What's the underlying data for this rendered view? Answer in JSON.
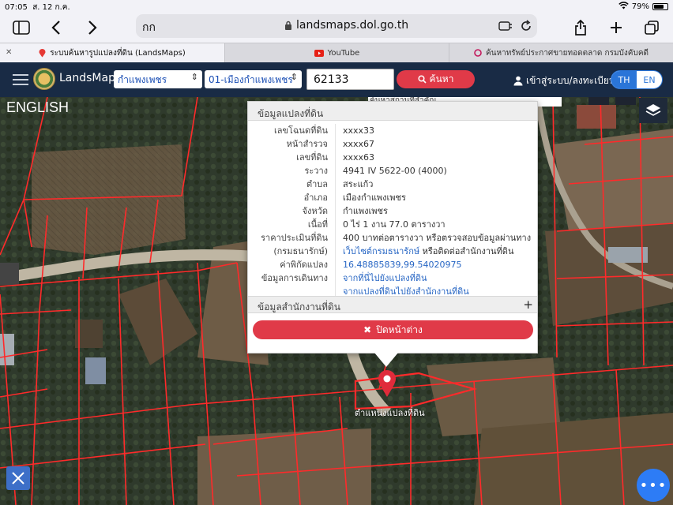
{
  "status_bar": {
    "time": "07:05",
    "date": "ส. 12 ก.ค.",
    "battery": "79%"
  },
  "browser": {
    "text_size_label": "กก",
    "url": "landsmaps.dol.go.th",
    "tabs": [
      {
        "title": "ระบบค้นหารูปแปลงที่ดิน (LandsMaps)",
        "active": true
      },
      {
        "title": "YouTube",
        "active": false
      },
      {
        "title": "ค้นหาทรัพย์ประกาศขายทอดตลาด กรมบังคับคดี",
        "active": false
      }
    ]
  },
  "header": {
    "brand": "LandsMaps",
    "province_select": "กำแพงเพชร",
    "district_select": "01-เมืองกำแพงเพชร",
    "parcel_number": "62133",
    "search_label": "ค้นหา",
    "login_label": "เข้าสู่ระบบ/ลงทะเบียน",
    "lang_th": "TH",
    "lang_en": "EN"
  },
  "map": {
    "english_label": "ENGLISH",
    "top_search_placeholder": "ค้นหาสถานที่สำคัญ",
    "pin_label": "ตำแหน่งแปลงที่ดิน",
    "parcel_line_color": "#ff2a2a",
    "pin_color": "#e02b3b"
  },
  "popup": {
    "title": "ข้อมูลแปลงที่ดิน",
    "rows": [
      {
        "label": "เลขโฉนดที่ดิน",
        "value": "xxxx33"
      },
      {
        "label": "หน้าสำรวจ",
        "value": "xxxx67"
      },
      {
        "label": "เลขที่ดิน",
        "value": "xxxx63"
      },
      {
        "label": "ระวาง",
        "value": "4941 IV 5622-00 (4000)"
      },
      {
        "label": "ตำบล",
        "value": "สระแก้ว"
      },
      {
        "label": "อำเภอ",
        "value": "เมืองกำแพงเพชร"
      },
      {
        "label": "จังหวัด",
        "value": "กำแพงเพชร"
      },
      {
        "label": "เนื้อที่",
        "value": "0 ไร่ 1 งาน 77.0 ตารางวา"
      },
      {
        "label": "ราคาประเมินที่ดิน",
        "value": "400 บาทต่อตารางวา หรือตรวจสอบข้อมูลผ่านทาง"
      },
      {
        "label": "(กรมธนารักษ์)",
        "value": "เว็บไซต์กรมธนารักษ์",
        "value_suffix": " หรือติดต่อสำนักงานที่ดิน"
      },
      {
        "label": "ค่าพิกัดแปลง",
        "value": "16.48885839,99.54020975"
      },
      {
        "label": "ข้อมูลการเดินทาง",
        "value": "จากที่นี่ไปยังแปลงที่ดิน"
      },
      {
        "label": "",
        "value": "จากแปลงที่ดินไปยังสำนักงานที่ดิน"
      }
    ],
    "section2": "ข้อมูลสำนักงานที่ดิน",
    "close_label": "ปิดหน้าต่าง"
  }
}
